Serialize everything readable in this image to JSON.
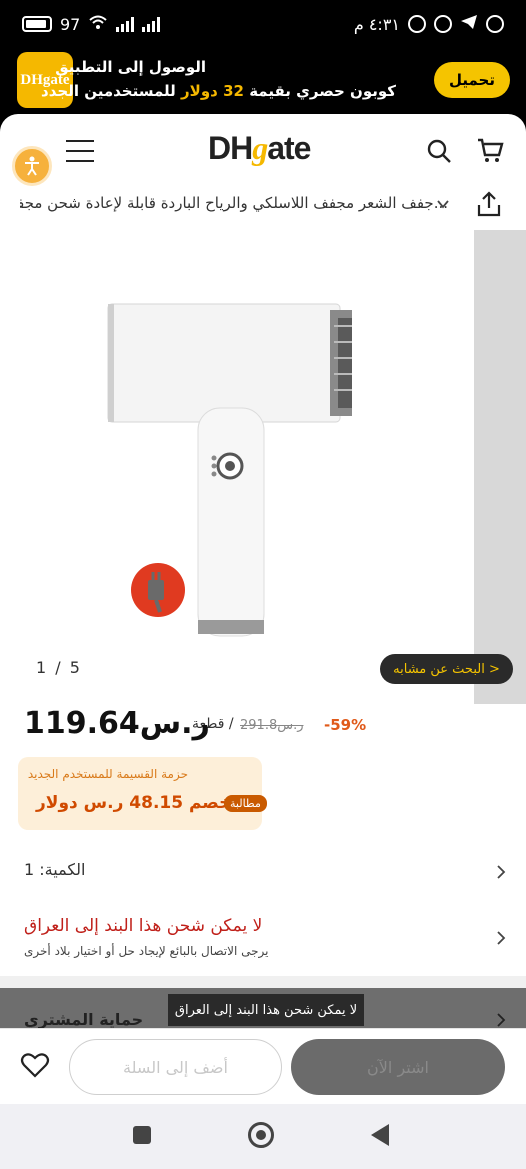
{
  "status_bar": {
    "time": "٤:٣١ م",
    "battery": "97"
  },
  "banner": {
    "logo_text": "DHgate",
    "title": "الوصول إلى التطبيق",
    "subtitle_pre": "كوبون حصري بقيمة",
    "subtitle_amount": "32 دولار",
    "subtitle_post": "للمستخدمين الجدد",
    "download_label": "تحميل"
  },
  "header": {
    "brand_left": "DH",
    "brand_g": "g",
    "brand_right": "ate"
  },
  "breadcrumb": {
    "text": "...جفف الشعر مجفف اللاسلكي والرياح الباردة قابلة لإعادة شحن مجفف"
  },
  "gallery": {
    "counter": "1 / 5",
    "similar_label": "< البحث عن مشابه"
  },
  "price": {
    "discount": "-59%",
    "old": "291.8ر.س",
    "unit": "قطعة /",
    "current": "ر.س119.64"
  },
  "coupon": {
    "title": "حزمة القسيمة للمستخدم الجديد",
    "tag": "مطالبة",
    "offer": "خصم 48.15 ر.س دولار"
  },
  "quantity": {
    "label": "الكمية: 1"
  },
  "shipping": {
    "title": "لا يمكن شحن هذا البند إلى العراق",
    "hint": "يرجى الاتصال بالبائع لإيجاد حل أو اختيار بلاد أخرى"
  },
  "protection": {
    "title": "حماية المشتري"
  },
  "toast": {
    "text": "لا يمكن شحن هذا البند إلى العراق"
  },
  "actions": {
    "add_to_cart": "أضف إلى السلة",
    "buy_now": "اشتر الآن"
  },
  "colors": {
    "brand_yellow": "#f5b800",
    "discount_orange": "#e05a1a",
    "error_red": "#c0201a"
  }
}
